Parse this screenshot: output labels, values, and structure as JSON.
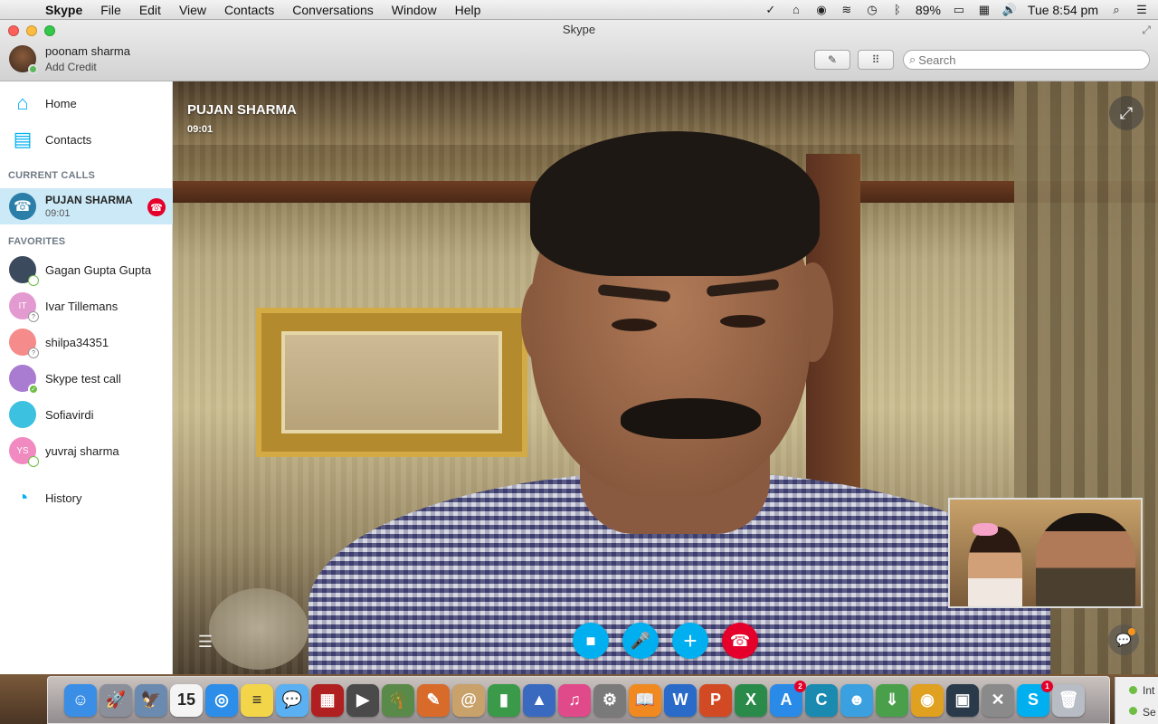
{
  "menubar": {
    "app_name": "Skype",
    "menus": [
      "File",
      "Edit",
      "View",
      "Contacts",
      "Conversations",
      "Window",
      "Help"
    ],
    "battery": "89%",
    "clock": "Tue 8:54 pm"
  },
  "window": {
    "title": "Skype",
    "profile_name": "poonam sharma",
    "profile_sub": "Add Credit",
    "search_placeholder": "Search"
  },
  "sidebar": {
    "home": "Home",
    "contacts": "Contacts",
    "current_calls_header": "CURRENT CALLS",
    "current_call": {
      "name": "PUJAN SHARMA",
      "duration": "09:01"
    },
    "favorites_header": "FAVORITES",
    "favorites": [
      {
        "name": "Gagan Gupta Gupta",
        "initials": "",
        "status": "offline",
        "color": "#3b4a5c"
      },
      {
        "name": "Ivar Tillemans",
        "initials": "IT",
        "status": "unknown",
        "color": "#e39ad0"
      },
      {
        "name": "shilpa34351",
        "initials": "",
        "status": "unknown",
        "color": "#f58b8b"
      },
      {
        "name": "Skype test call",
        "initials": "",
        "status": "online",
        "color": "#a97bd1"
      },
      {
        "name": "Sofiavirdi",
        "initials": "",
        "status": "none",
        "color": "#3cc1e0"
      },
      {
        "name": "yuvraj sharma",
        "initials": "YS",
        "status": "offline",
        "color": "#f08ac0"
      }
    ],
    "history": "History"
  },
  "call": {
    "caller_name": "PUJAN SHARMA",
    "duration": "09:01"
  },
  "dock": {
    "apps": [
      {
        "name": "finder",
        "glyph": "☺",
        "color": "#3a8ee6"
      },
      {
        "name": "launchpad",
        "glyph": "🚀",
        "color": "#8a8f99"
      },
      {
        "name": "preview",
        "glyph": "🦅",
        "color": "#6a8ab0"
      },
      {
        "name": "calendar",
        "glyph": "15",
        "color": "#f4f4f4"
      },
      {
        "name": "safari",
        "glyph": "◎",
        "color": "#2c8ee8"
      },
      {
        "name": "stickies",
        "glyph": "≡",
        "color": "#f3d54a"
      },
      {
        "name": "messages",
        "glyph": "💬",
        "color": "#5ab0f0"
      },
      {
        "name": "photo-booth",
        "glyph": "▦",
        "color": "#b02020"
      },
      {
        "name": "facetime",
        "glyph": "▶",
        "color": "#4a4a4a"
      },
      {
        "name": "iphoto",
        "glyph": "🌴",
        "color": "#5a8a4a"
      },
      {
        "name": "pages",
        "glyph": "✎",
        "color": "#d86a2a"
      },
      {
        "name": "contacts",
        "glyph": "@",
        "color": "#c9a16a"
      },
      {
        "name": "numbers",
        "glyph": "▮",
        "color": "#3a9a4a"
      },
      {
        "name": "keynote",
        "glyph": "▲",
        "color": "#3a6ac0"
      },
      {
        "name": "itunes",
        "glyph": "♫",
        "color": "#e04a8a"
      },
      {
        "name": "system-preferences",
        "glyph": "⚙",
        "color": "#7a7a7a"
      },
      {
        "name": "ibooks",
        "glyph": "📖",
        "color": "#f08a20"
      },
      {
        "name": "word",
        "glyph": "W",
        "color": "#2a6ac8"
      },
      {
        "name": "powerpoint",
        "glyph": "P",
        "color": "#d24a24"
      },
      {
        "name": "excel",
        "glyph": "X",
        "color": "#2a8a4a"
      },
      {
        "name": "app-store",
        "glyph": "A",
        "color": "#2a8ae8",
        "badge": "2"
      },
      {
        "name": "ccleaner",
        "glyph": "C",
        "color": "#1a8ab0"
      },
      {
        "name": "people-app",
        "glyph": "☻",
        "color": "#3aa0e0"
      },
      {
        "name": "downloader",
        "glyph": "⇓",
        "color": "#4aa04a"
      },
      {
        "name": "chrome",
        "glyph": "◉",
        "color": "#e0a020"
      },
      {
        "name": "monitor-app",
        "glyph": "▣",
        "color": "#2a3a4a"
      },
      {
        "name": "utilities",
        "glyph": "✕",
        "color": "#8a8a8a"
      },
      {
        "name": "skype",
        "glyph": "S",
        "color": "#00aff0",
        "badge": "1"
      },
      {
        "name": "trash",
        "glyph": "🗑",
        "color": "#b8bcc4"
      }
    ],
    "extra_lines": [
      "Int",
      "Se"
    ]
  }
}
